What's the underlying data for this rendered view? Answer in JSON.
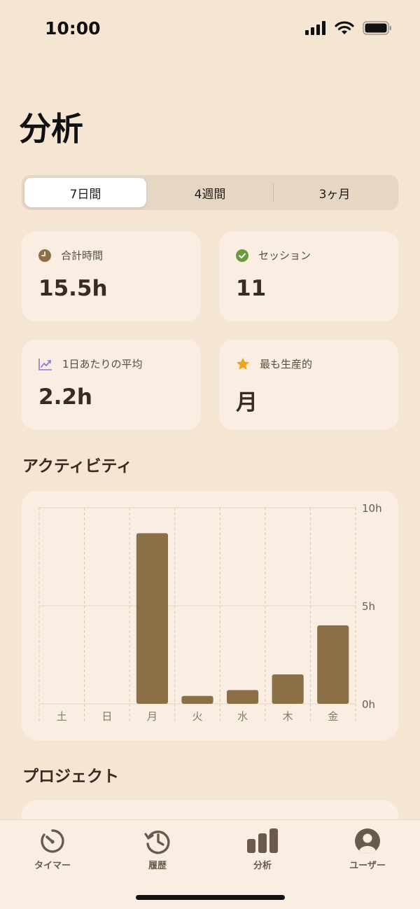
{
  "status_bar": {
    "time": "10:00",
    "icons": [
      "signal-icon",
      "wifi-icon",
      "battery-icon"
    ]
  },
  "page": {
    "title": "分析"
  },
  "segments": [
    {
      "label": "7日間",
      "selected": true
    },
    {
      "label": "4週間",
      "selected": false
    },
    {
      "label": "3ヶ月",
      "selected": false
    }
  ],
  "stats": {
    "total_time": {
      "label": "合計時間",
      "value": "15.5h",
      "icon": "clock-icon",
      "color": "#8b6f47"
    },
    "sessions": {
      "label": "セッション",
      "value": "11",
      "icon": "check-circle-icon",
      "color": "#6a9a3e"
    },
    "daily_average": {
      "label": "1日あたりの平均",
      "value": "2.2h",
      "icon": "trend-chart-icon",
      "color": "#8a78d8"
    },
    "most_productive": {
      "label": "最も生産的",
      "value": "月",
      "icon": "star-icon",
      "color": "#f4a21e"
    }
  },
  "activity": {
    "title": "アクティビティ"
  },
  "chart_data": {
    "type": "bar",
    "categories": [
      "土",
      "日",
      "月",
      "火",
      "水",
      "木",
      "金"
    ],
    "values": [
      0,
      0,
      8.7,
      0.4,
      0.7,
      1.5,
      4.0
    ],
    "ylim": [
      0,
      10
    ],
    "y_ticks": [
      "0h",
      "5h",
      "10h"
    ],
    "y_tick_values": [
      0,
      5,
      10
    ],
    "y_axis_position": "right",
    "bar_color": "#8b6f47",
    "grid": true
  },
  "projects": {
    "title": "プロジェクト"
  },
  "tab_bar": {
    "tabs": [
      {
        "label": "タイマー",
        "icon": "timer-icon"
      },
      {
        "label": "履歴",
        "icon": "history-icon"
      },
      {
        "label": "分析",
        "icon": "bar-chart-icon"
      },
      {
        "label": "ユーザー",
        "icon": "user-icon"
      }
    ]
  }
}
